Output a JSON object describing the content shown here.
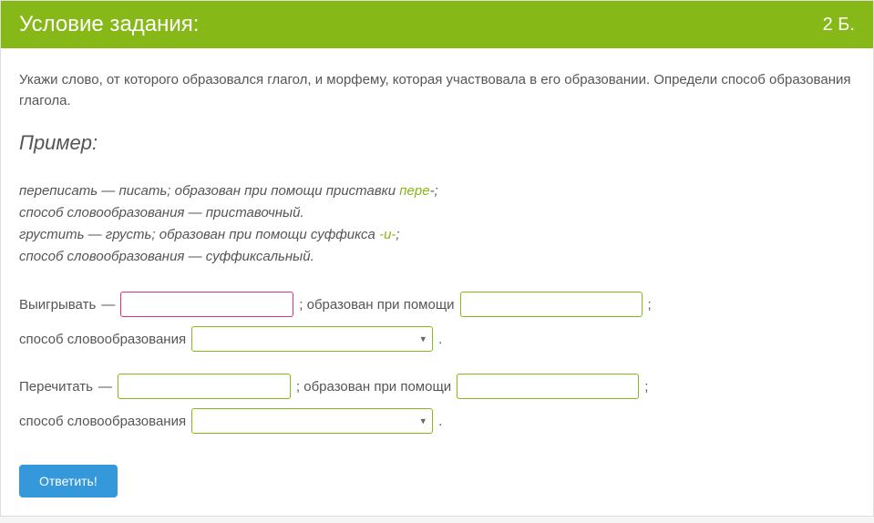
{
  "header": {
    "title": "Условие задания:",
    "points": "2 Б."
  },
  "instruction": "Укажи слово, от которого образовался глагол, и морфему, которая участвовала в его образовании. Определи способ образования глагола.",
  "example": {
    "title": "Пример:",
    "line1_a": "переписать — писать; образован при помощи приставки ",
    "line1_b": "пере",
    "line1_c": "-;",
    "line2": "способ словообразования — приставочный.",
    "line3_a": "грустить — грусть; образован при помощи суффикса ",
    "line3_b": "-и-",
    "line3_c": ";",
    "line4": "способ словообразования — суффиксальный."
  },
  "tasks": [
    {
      "word": "Выигрывать",
      "dash": "—",
      "formed_label": "; образован при помощи",
      "semicolon": ";",
      "method_label": "способ словообразования",
      "period": "."
    },
    {
      "word": "Перечитать",
      "dash": "—",
      "formed_label": "; образован при помощи",
      "semicolon": ";",
      "method_label": "способ словообразования",
      "period": "."
    }
  ],
  "submit": "Ответить!"
}
